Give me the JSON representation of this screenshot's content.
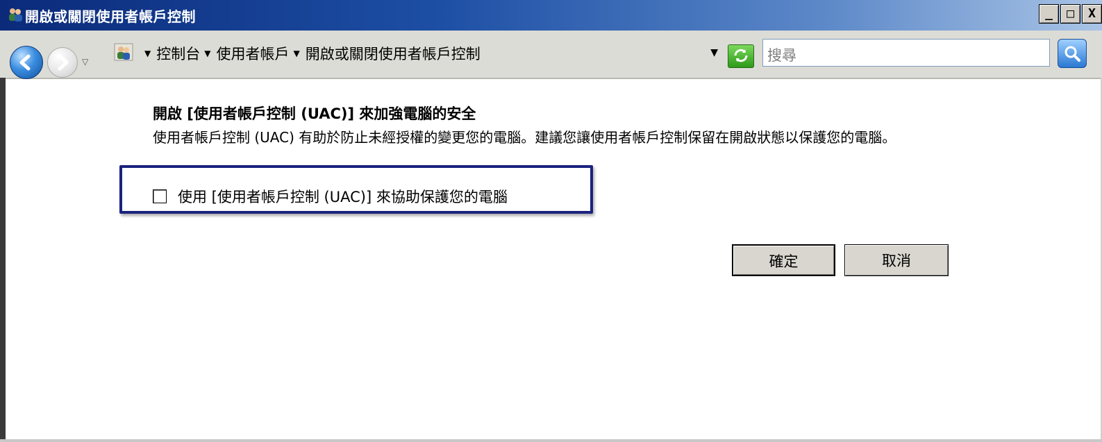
{
  "window": {
    "title": "開啟或關閉使用者帳戶控制",
    "controls": {
      "minimize": "_",
      "maximize": "□",
      "close": "X"
    }
  },
  "navigation": {
    "breadcrumbs": [
      "控制台",
      "使用者帳戶",
      "開啟或關閉使用者帳戶控制"
    ],
    "search_placeholder": "搜尋"
  },
  "content": {
    "heading": "開啟 [使用者帳戶控制 (UAC)] 來加強電腦的安全",
    "description": "使用者帳戶控制 (UAC) 有助於防止未經授權的變更您的電腦。建議您讓使用者帳戶控制保留在開啟狀態以保護您的電腦。",
    "checkbox_label": "使用 [使用者帳戶控制 (UAC)] 來協助保護您的電腦",
    "checkbox_checked": false
  },
  "buttons": {
    "ok": "確定",
    "cancel": "取消"
  },
  "colors": {
    "title_bar": "#1d4fa5",
    "highlight_border": "#1a237e"
  }
}
